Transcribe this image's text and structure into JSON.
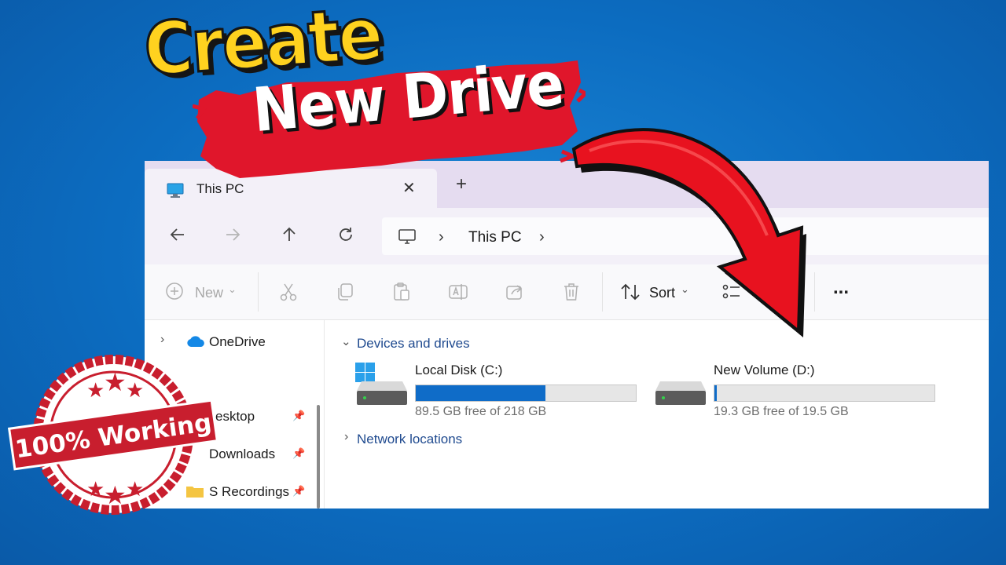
{
  "overlay": {
    "title_line1": "Create",
    "title_line2": "New Drive",
    "badge_text": "100% Working",
    "colors": {
      "yellow": "#ffd21f",
      "red": "#e0162b",
      "badge_red": "#c81e2e"
    }
  },
  "window": {
    "tab": {
      "title": "This PC",
      "close": "✕",
      "new_tab": "+"
    },
    "address": {
      "breadcrumb": "This PC"
    },
    "toolbar": {
      "new_label": "New",
      "sort_label": "Sort",
      "more_label": "..."
    },
    "sidebar": {
      "items": [
        {
          "label": "OneDrive"
        },
        {
          "label": "esktop"
        },
        {
          "label": "Downloads"
        },
        {
          "label": "S Recordings"
        }
      ]
    },
    "content": {
      "section_devices": "Devices and drives",
      "section_network": "Network locations",
      "drives": [
        {
          "name": "Local Disk (C:)",
          "free": "89.5 GB free of 218 GB",
          "used_fraction": 0.59
        },
        {
          "name": "New Volume (D:)",
          "free": "19.3 GB free of 19.5 GB",
          "used_fraction": 0.01
        }
      ]
    }
  }
}
